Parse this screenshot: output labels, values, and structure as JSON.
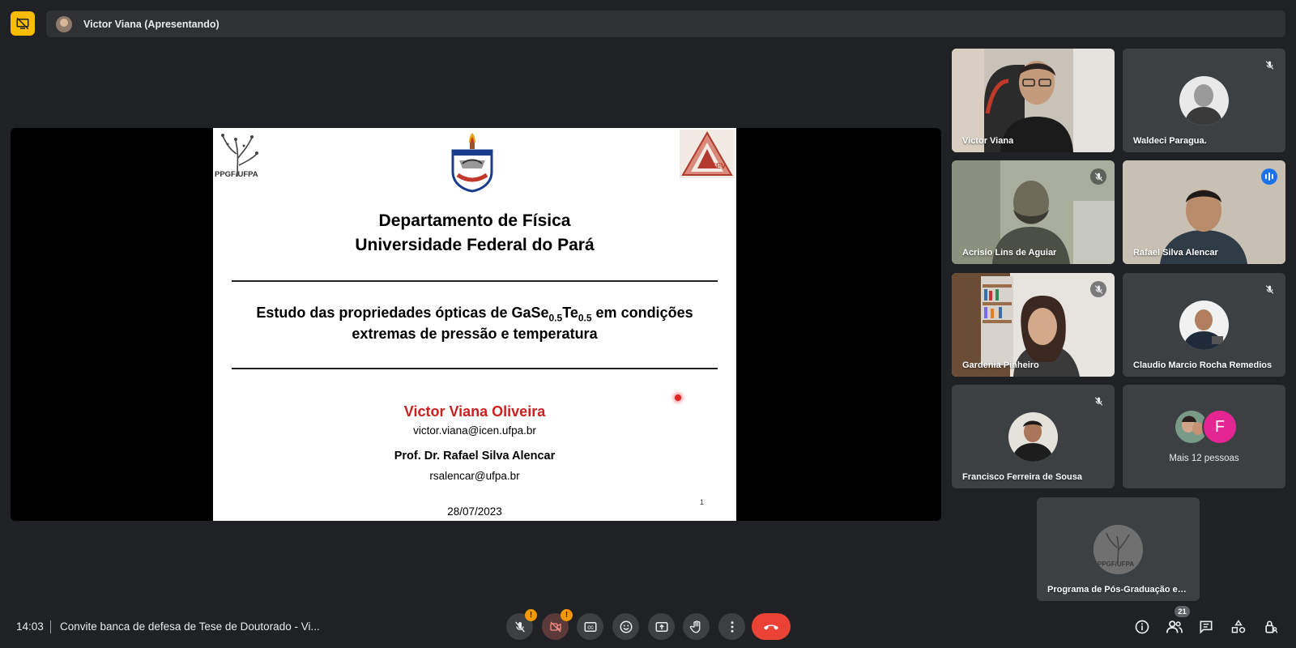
{
  "presenter": {
    "label": "Victor Viana (Apresentando)"
  },
  "slide": {
    "logo_left": "PPGF/UFPA",
    "logo_right": "GEEV",
    "dept_line1": "Departamento de Física",
    "dept_line2": "Universidade Federal do Pará",
    "thesis_pre": "Estudo das propriedades ópticas de GaSe",
    "thesis_sub1": "0.5",
    "thesis_mid": "Te",
    "thesis_sub2": "0.5",
    "thesis_post": " em condições",
    "thesis_line2": "extremas de pressão e temperatura",
    "author": "Victor Viana Oliveira",
    "author_email": "victor.viana@icen.ufpa.br",
    "advisor": "Prof. Dr. Rafael Silva Alencar",
    "advisor_email": "rsalencar@ufpa.br",
    "date": "28/07/2023",
    "page_number": "1"
  },
  "participants": [
    {
      "name": "Victor Viana",
      "muted": false,
      "video": true
    },
    {
      "name": "Waldeci Paragua.",
      "muted": true,
      "video": false
    },
    {
      "name": "Acrisio Lins de Aguiar",
      "muted": true,
      "video": true
    },
    {
      "name": "Rafael Silva Alencar",
      "muted": false,
      "speaking": true,
      "video": true
    },
    {
      "name": "Gardenia Pinheiro",
      "muted": true,
      "video": true
    },
    {
      "name": "Claudio Marcio Rocha Remedios",
      "muted": true,
      "video": false
    },
    {
      "name": "Francisco Ferreira de Sousa",
      "muted": true,
      "video": false
    },
    {
      "name": "Mais 12 pessoas",
      "avatar_letter": "F",
      "video": false
    },
    {
      "name": "Programa de Pós-Graduação em Física",
      "video": false,
      "avatar_text": "PPGF/UFPA"
    }
  ],
  "bottom": {
    "time": "14:03",
    "meeting_title": "Convite banca de defesa de Tese de Doutorado - Vi...",
    "people_count": "21",
    "mic_alert": "!",
    "cam_alert": "!"
  },
  "colors": {
    "accent_yellow": "#fbbc04",
    "hangup_red": "#ea4335",
    "speaking_blue": "#8ab4f8",
    "background": "#202124",
    "tile": "#3c4043"
  }
}
